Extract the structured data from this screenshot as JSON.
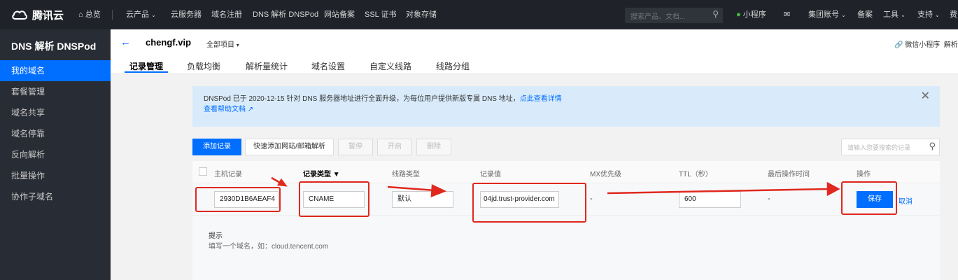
{
  "topbar": {
    "brand": "腾讯云",
    "overview": "总览",
    "nav": [
      "云产品",
      "云服务器",
      "域名注册",
      "DNS 解析 DNSPod",
      "网站备案",
      "SSL 证书",
      "对象存储"
    ],
    "search_placeholder": "搜索产品、文档...",
    "mini_program": "小程序",
    "group_account": "集团账号",
    "beian": "备案",
    "tools": "工具",
    "support": "支持",
    "more": "费"
  },
  "sidebar": {
    "title": "DNS 解析 DNSPod",
    "items": [
      {
        "label": "我的域名",
        "active": true
      },
      {
        "label": "套餐管理"
      },
      {
        "label": "域名共享"
      },
      {
        "label": "域名停靠"
      },
      {
        "label": "反向解析"
      },
      {
        "label": "批量操作"
      },
      {
        "label": "协作子域名"
      }
    ]
  },
  "header": {
    "domain": "chengf.vip",
    "project": "全部项目",
    "wechat_mini": "微信小程序",
    "wechat_mini_more": "解析",
    "tabs": [
      "记录管理",
      "负载均衡",
      "解析量统计",
      "域名设置",
      "自定义线路",
      "线路分组"
    ]
  },
  "notice": {
    "text": "DNSPod 已于 2020-12-15 针对 DNS 服务器地址进行全面升级，为每位用户提供新版专属 DNS 地址，",
    "link": "点此查看详情",
    "help": "查看帮助文档"
  },
  "toolbar": {
    "add_record": "添加记录",
    "quick_add": "快速添加网站/邮箱解析",
    "pause": "暂停",
    "enable": "开启",
    "delete": "删除",
    "search_placeholder": "请输入您要搜索的记录"
  },
  "table": {
    "columns": [
      "主机记录",
      "记录类型",
      "线路类型",
      "记录值",
      "MX优先级",
      "TTL（秒）",
      "最后操作时间",
      "操作"
    ],
    "edit_row": {
      "host": "2930D1B6AEAF4",
      "type": "CNAME",
      "line": "默认",
      "value": "04jd.trust-provider.com",
      "mx": "-",
      "ttl": "600",
      "last_op": "-",
      "save": "保存",
      "cancel": "取消"
    },
    "hint_title": "提示",
    "hint_text": "填写一个域名，如：cloud.tencent.com"
  },
  "colors": {
    "accent": "#006eff",
    "annotation": "#e0281e"
  }
}
